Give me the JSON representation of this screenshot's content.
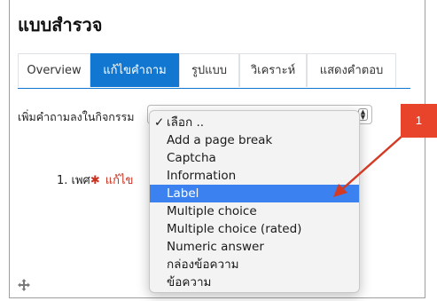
{
  "page": {
    "title": "แบบสำรวจ"
  },
  "tabs": [
    {
      "label": "Overview",
      "active": false
    },
    {
      "label": "แก้ไขคำถาม",
      "active": true
    },
    {
      "label": "รูปแบบ",
      "active": false
    },
    {
      "label": "วิเคราะห์",
      "active": false
    },
    {
      "label": "แสดงคำตอบ",
      "active": false
    }
  ],
  "form": {
    "add_question_label": "เพิ่มคำถามลงในกิจกรรม",
    "select_arrows": "▲▼"
  },
  "question": {
    "number_text": "1. เพศ",
    "required_mark": "✱",
    "edit_text": "แก้ไข"
  },
  "dropdown": {
    "check_mark": "✓",
    "selected_index": 0,
    "highlighted_index": 4,
    "options": [
      "เลือก ..",
      "Add a page break",
      "Captcha",
      "Information",
      "Label",
      "Multiple choice",
      "Multiple choice (rated)",
      "Numeric answer",
      "กล่องข้อความ",
      "ข้อความ"
    ]
  },
  "annotation": {
    "callout_number": "1",
    "color": "#e8432b"
  },
  "colors": {
    "accent": "#1177d1",
    "highlight": "#3b82f0",
    "required": "#ca3120"
  },
  "icons": {
    "move": "move-icon",
    "select_arrows": "chevron-updown-icon"
  }
}
